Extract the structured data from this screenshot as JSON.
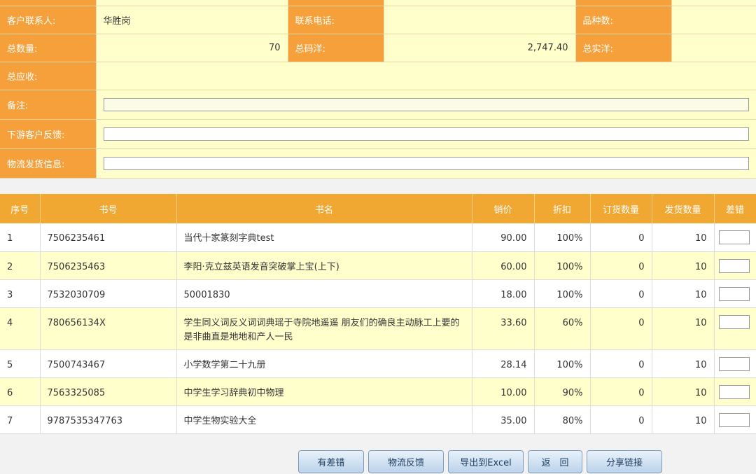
{
  "info": {
    "contact_label": "客户联系人:",
    "contact_value": "华胜岗",
    "phone_label": "联系电话:",
    "phone_value": "",
    "variety_label": "品种数:",
    "variety_value": "",
    "total_qty_label": "总数量:",
    "total_qty_value": "70",
    "total_price_label": "总码洋:",
    "total_price_value": "2,747.40",
    "total_actual_label": "总实洋:",
    "total_actual_value": "",
    "total_receivable_label": "总应收:",
    "total_receivable_value": "",
    "remark_label": "备注:",
    "feedback_label": "下游客户反馈:",
    "logistics_label": "物流发货信息:"
  },
  "grid": {
    "headers": [
      "序号",
      "书号",
      "书名",
      "销价",
      "折扣",
      "订货数量",
      "发货数量",
      "差错"
    ],
    "rows": [
      {
        "no": "1",
        "isbn": "7506235461",
        "title": "当代十家篆刻字典test",
        "price": "90.00",
        "discount": "100%",
        "ordered": "0",
        "shipped": "10"
      },
      {
        "no": "2",
        "isbn": "7506235463",
        "title": "李阳·克立兹英语发音突破掌上宝(上下)",
        "price": "60.00",
        "discount": "100%",
        "ordered": "0",
        "shipped": "10"
      },
      {
        "no": "3",
        "isbn": "7532030709",
        "title": "50001830",
        "price": "18.00",
        "discount": "100%",
        "ordered": "0",
        "shipped": "10"
      },
      {
        "no": "4",
        "isbn": "780656134X",
        "title": "学生同义词反义词词典瑶于寺院地遥遥 朋友们的确良主动脉工上要的是非曲直是地地和产人一民",
        "price": "33.60",
        "discount": "60%",
        "ordered": "0",
        "shipped": "10"
      },
      {
        "no": "5",
        "isbn": "7500743467",
        "title": "小学数学第二十九册",
        "price": "28.14",
        "discount": "100%",
        "ordered": "0",
        "shipped": "10"
      },
      {
        "no": "6",
        "isbn": "7563325085",
        "title": "中学生学习辞典初中物理",
        "price": "10.00",
        "discount": "90%",
        "ordered": "0",
        "shipped": "10"
      },
      {
        "no": "7",
        "isbn": "9787535347763",
        "title": "中学生物实验大全",
        "price": "35.00",
        "discount": "80%",
        "ordered": "0",
        "shipped": "10"
      }
    ]
  },
  "buttons": {
    "has_error": "有差错",
    "logistics_feedback": "物流反馈",
    "export_excel": "导出到Excel",
    "back": "返　回",
    "share_link": "分享链接"
  }
}
